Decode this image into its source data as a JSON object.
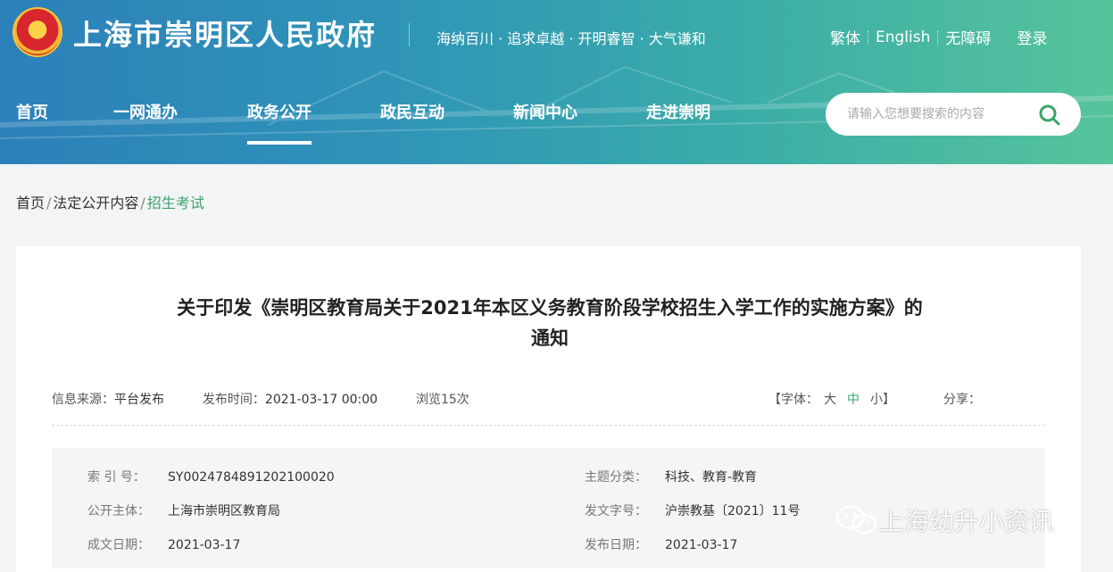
{
  "header": {
    "site_title": "上海市崇明区人民政府",
    "slogan": "海纳百川 · 追求卓越 · 开明睿智 · 大气谦和",
    "top_links": [
      "繁体",
      "English",
      "无障碍"
    ],
    "login": "登录"
  },
  "nav": {
    "items": [
      "首页",
      "一网通办",
      "政务公开",
      "政民互动",
      "新闻中心",
      "走进崇明"
    ],
    "active": "政务公开"
  },
  "search": {
    "placeholder": "请输入您想要搜索的内容"
  },
  "breadcrumb": [
    "首页",
    "法定公开内容",
    "招生考试"
  ],
  "article": {
    "title_line1": "关于印发《崇明区教育局关于2021年本区义务教育阶段学校招生入学工作的实施方案》的",
    "title_line2": "通知",
    "source_label": "信息来源：",
    "source": "平台发布",
    "publish_time_label": "发布时间：",
    "publish_time": "2021-03-17 00:00",
    "views": "浏览15次",
    "font_label": "【字体：",
    "font_large": "大",
    "font_medium": "中",
    "font_small": "小】",
    "share_label": "分享："
  },
  "info": {
    "index_label": "索 引 号：",
    "index": "SY0024784891202100020",
    "topic_label": "主题分类：",
    "topic": "科技、教育-教育",
    "issuer_label": "公开主体：",
    "issuer": "上海市崇明区教育局",
    "doc_no_label": "发文字号：",
    "doc_no": "沪崇教基〔2021〕11号",
    "created_label": "成文日期：",
    "created": "2021-03-17",
    "published_label": "发布日期：",
    "published": "2021-03-17"
  },
  "watermark": "上海幼升小资讯",
  "colors": {
    "accent": "#3aa36b",
    "header_start": "#2c80b9",
    "header_end": "#56c49b"
  }
}
